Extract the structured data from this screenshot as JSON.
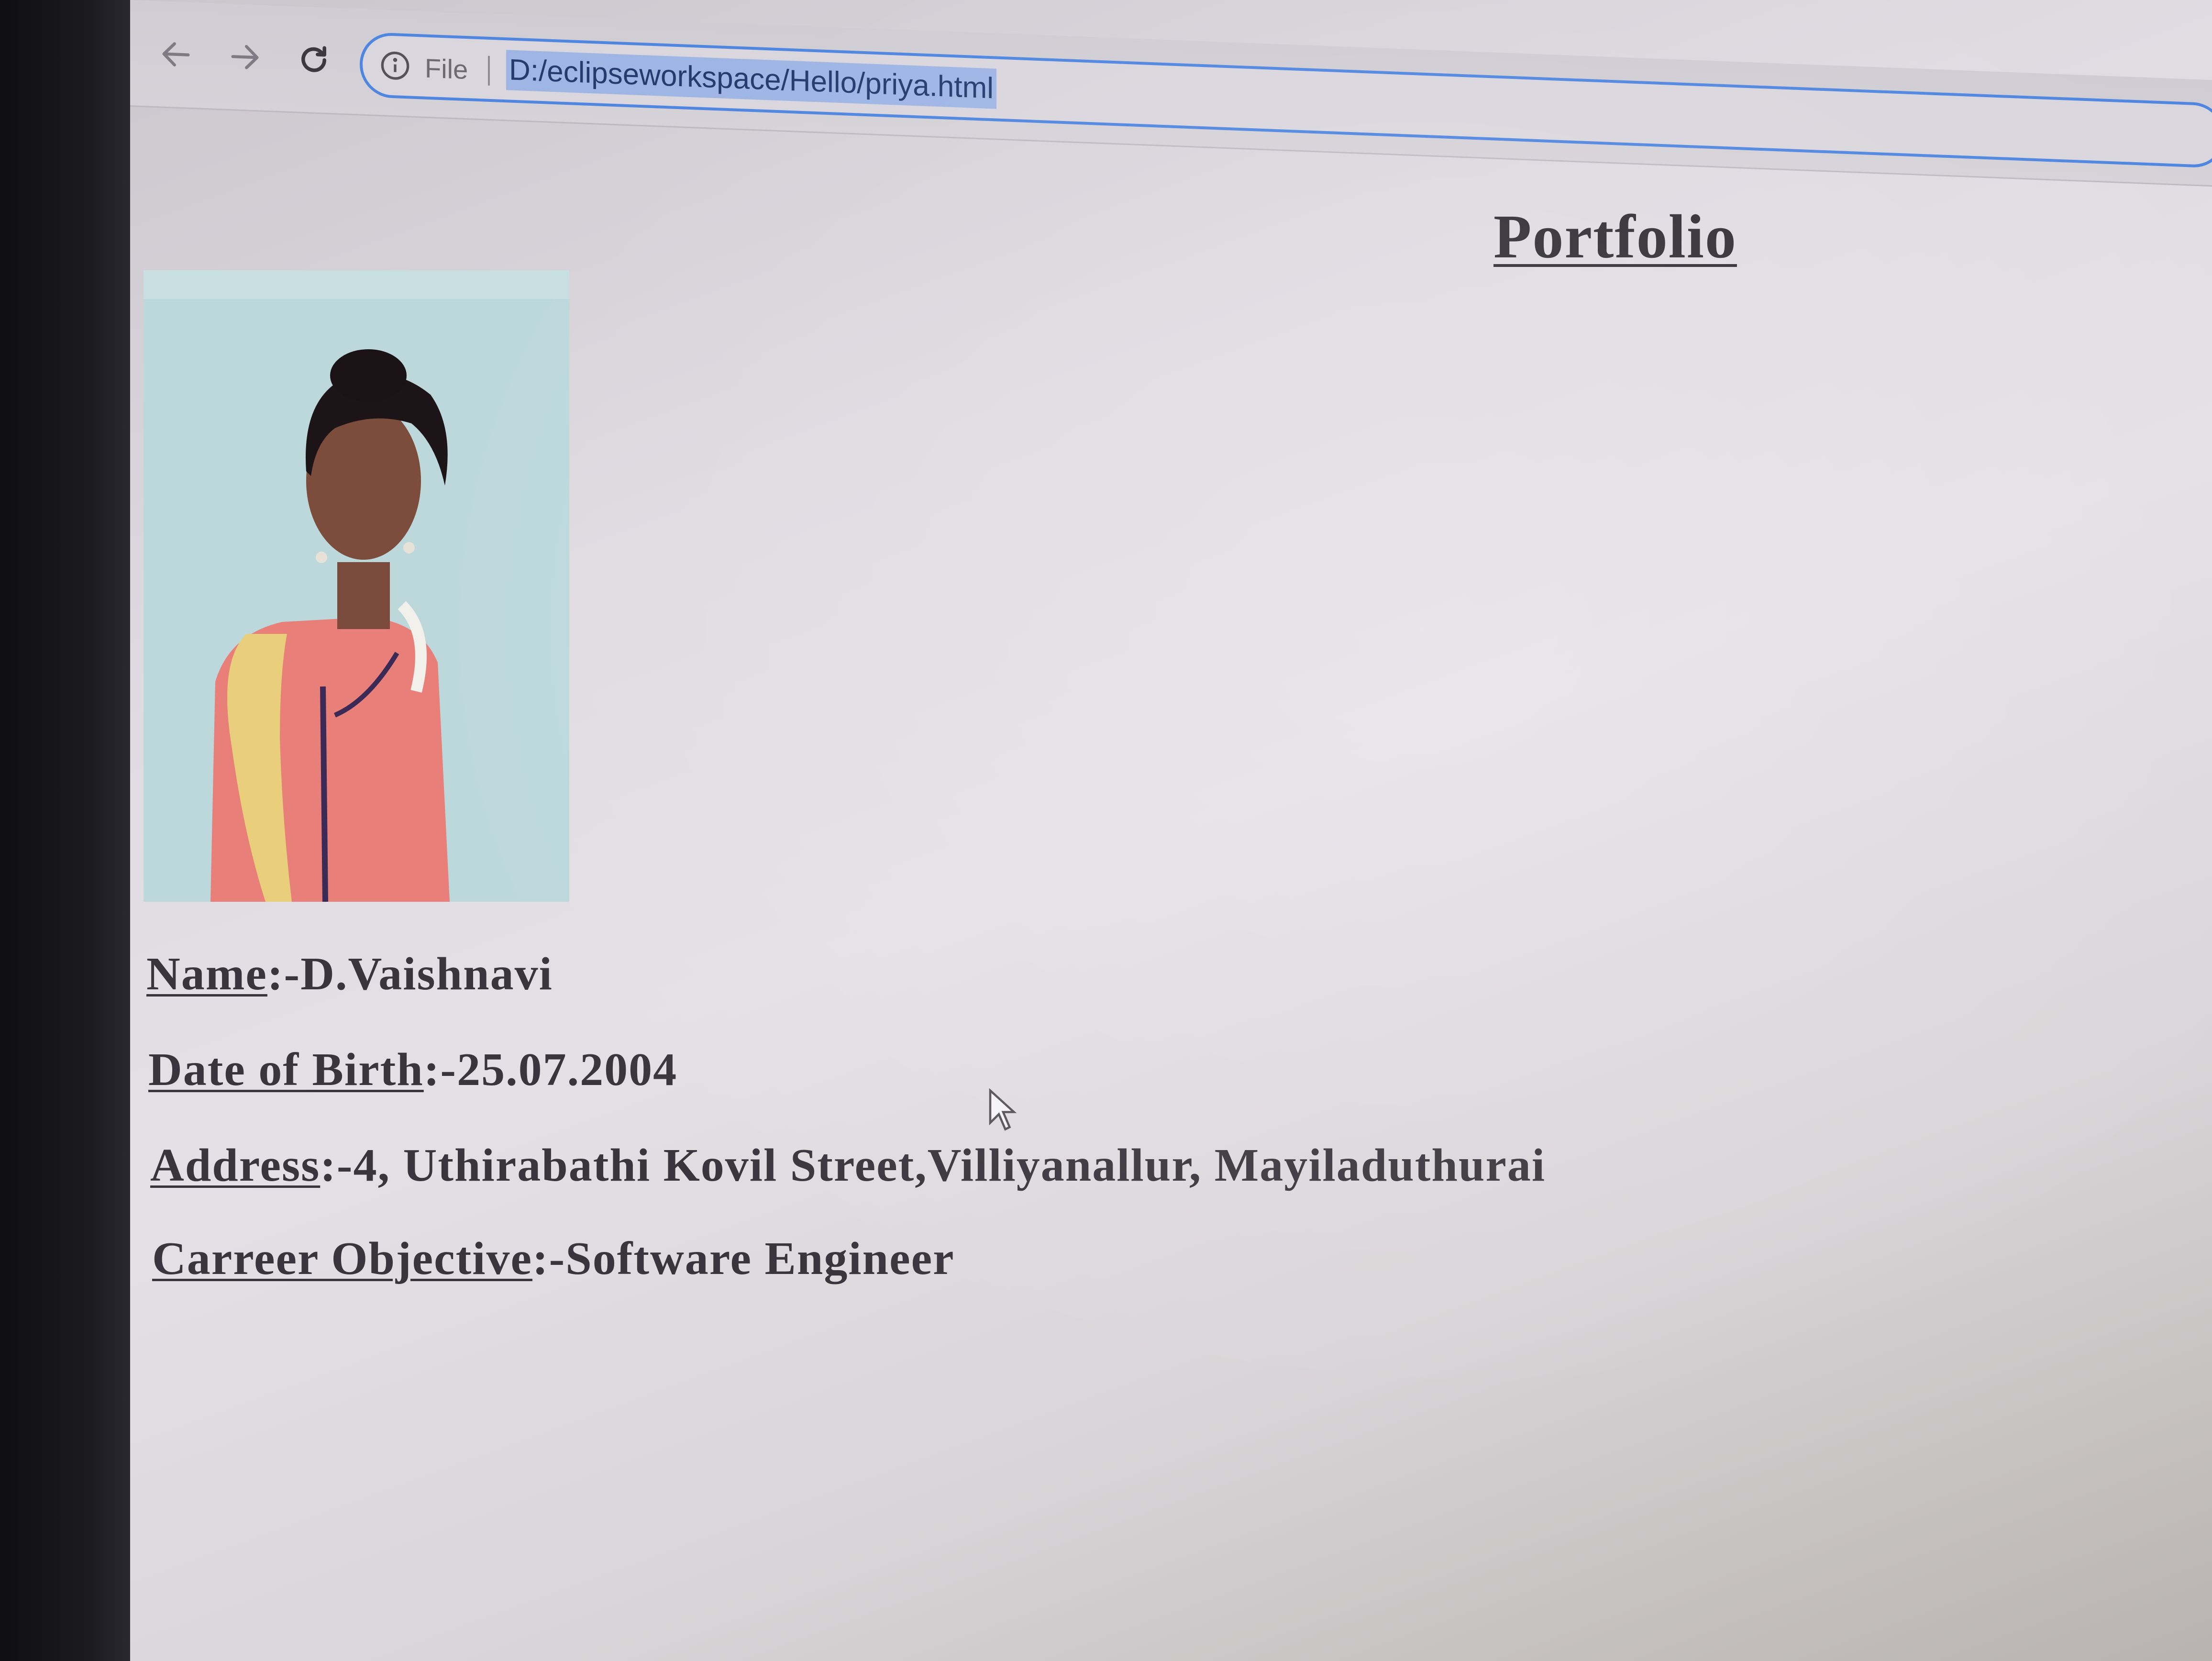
{
  "browser": {
    "scheme_label": "File",
    "url": "D:/eclipseworkspace/Hello/priya.html",
    "accent_color": "#4f86e0",
    "selection_color": "#9fb5e4",
    "icons": {
      "back": "arrow-left-icon",
      "forward": "arrow-right-icon",
      "reload": "reload-icon",
      "info": "info-circle-icon"
    }
  },
  "page": {
    "title": "Portfolio",
    "photo": "profile-photo",
    "fields": {
      "name": {
        "label": "Name",
        "separator": ":-",
        "value": "D.Vaishnavi"
      },
      "dob": {
        "label": "Date of Birth",
        "separator": ":-",
        "value": "25.07.2004"
      },
      "address": {
        "label": "Address",
        "separator": ":-",
        "value": "4, Uthirabathi Kovil Street,Villiyanallur, Mayiladuthurai"
      },
      "objective": {
        "label": "Carreer Objective",
        "separator": ":-",
        "value": "Software Engineer"
      }
    }
  }
}
